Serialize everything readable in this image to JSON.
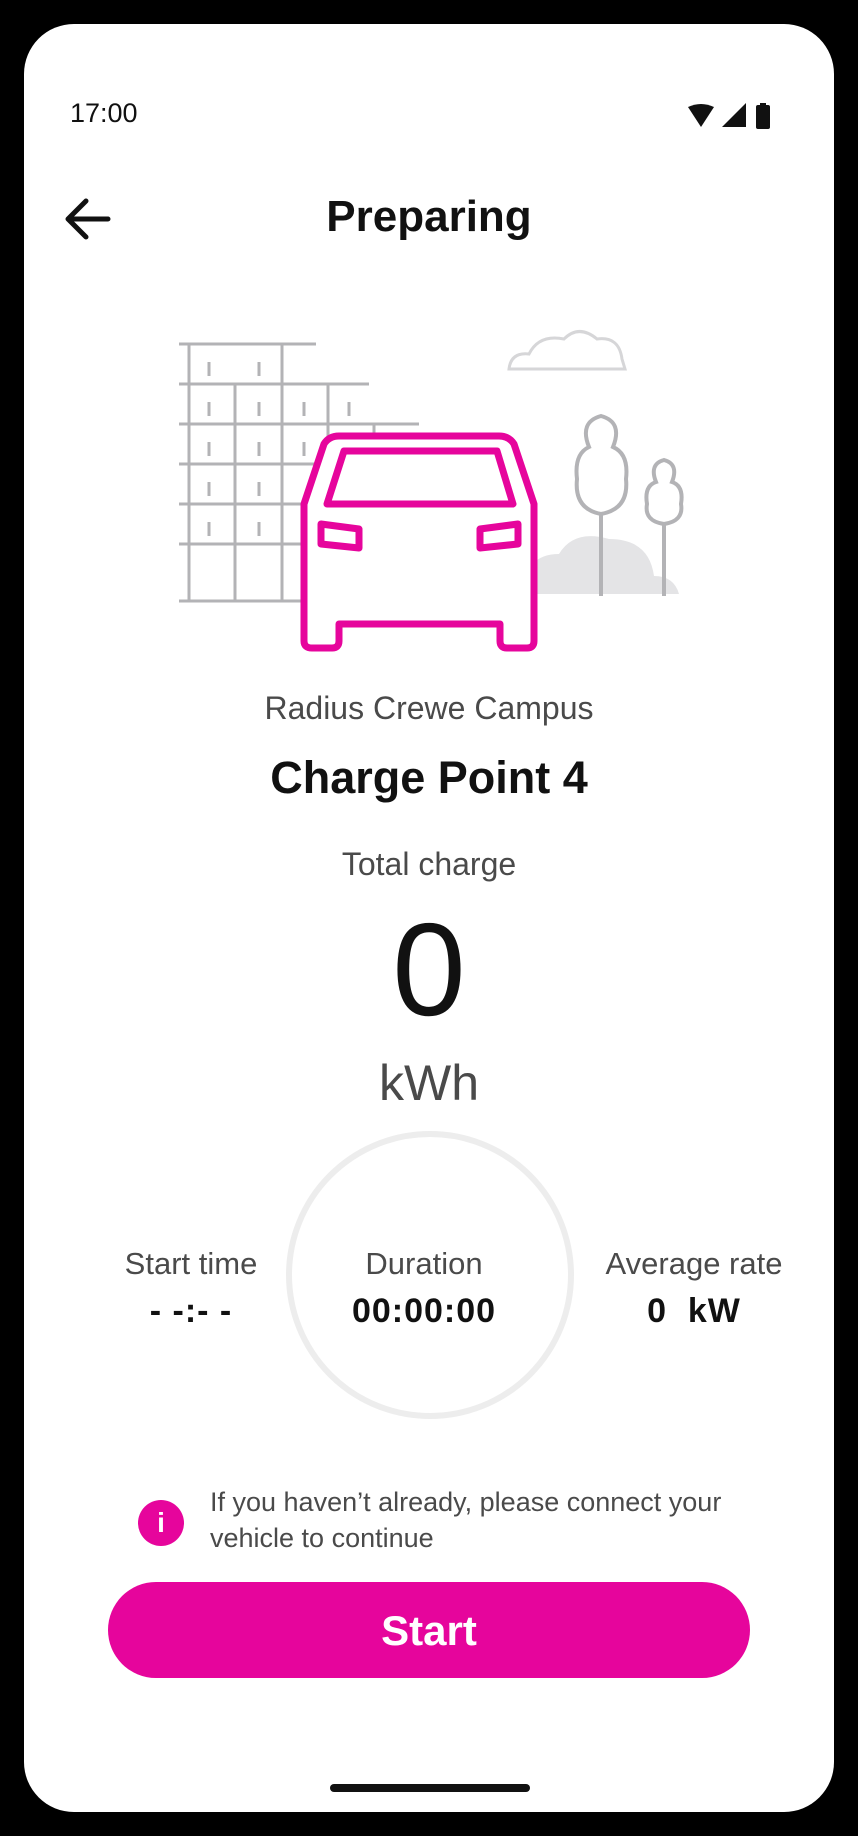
{
  "status_bar": {
    "time": "17:00",
    "icons": [
      "wifi-icon",
      "signal-icon",
      "battery-icon"
    ]
  },
  "header": {
    "title": "Preparing",
    "back_icon": "arrow-left-icon"
  },
  "location": {
    "site_name": "Radius Crewe Campus",
    "charge_point": "Charge Point 4"
  },
  "total_charge": {
    "label": "Total charge",
    "value": "0",
    "unit": "kWh"
  },
  "stats": {
    "start_time": {
      "label": "Start time",
      "value": "- -:- -"
    },
    "duration": {
      "label": "Duration",
      "value": "00:00:00"
    },
    "average_rate": {
      "label": "Average rate",
      "value": "0  kW"
    }
  },
  "info": {
    "icon": "info-icon",
    "icon_glyph": "i",
    "message": "If you haven’t already, please connect your vehicle to continue"
  },
  "actions": {
    "start_label": "Start"
  },
  "colors": {
    "accent": "#e6059c",
    "text_primary": "#111111",
    "text_secondary": "#4a4a4a",
    "illustration_grey": "#b3b3b6"
  }
}
